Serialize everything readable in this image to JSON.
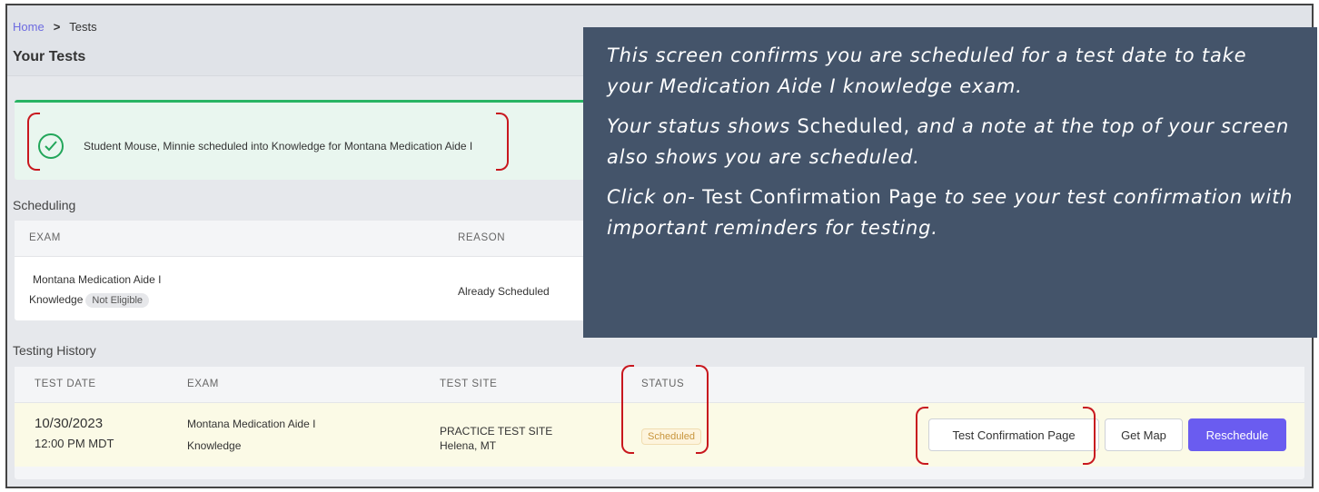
{
  "breadcrumb": {
    "home": "Home",
    "separator": ">",
    "current": "Tests"
  },
  "page_title": "Your Tests",
  "alert": {
    "icon": "check-circle-icon",
    "message": "Student Mouse, Minnie scheduled into Knowledge for Montana Medication Aide I"
  },
  "scheduling": {
    "label": "Scheduling",
    "columns": [
      "EXAM",
      "REASON"
    ],
    "row": {
      "exam": "Montana Medication Aide I",
      "type": "Knowledge",
      "eligibility": "Not Eligible",
      "reason": "Already Scheduled"
    }
  },
  "history": {
    "label": "Testing History",
    "columns": [
      "TEST DATE",
      "EXAM",
      "TEST SITE",
      "STATUS"
    ],
    "row": {
      "date": "10/30/2023",
      "time": "12:00 PM MDT",
      "exam": "Montana Medication Aide I",
      "type": "Knowledge",
      "site": "PRACTICE TEST SITE",
      "location": "Helena, MT",
      "status": "Scheduled"
    },
    "buttons": {
      "confirmation": "Test Confirmation Page",
      "map": "Get Map",
      "reschedule": "Reschedule"
    }
  },
  "overlay": {
    "p1": "This screen confirms you are scheduled for a test date to take your Medication Aide I knowledge exam.",
    "p2_pre": "Your status shows ",
    "p2_bold": "Scheduled,",
    "p2_post": " and a note at the top of your screen also shows you are scheduled.",
    "p3_pre": "Click on- ",
    "p3_bold": "Test Confirmation Page",
    "p3_post": " to see your test confirmation with important reminders for testing."
  },
  "colors": {
    "accent": "#6a5cf0",
    "success": "#28b463",
    "annotation": "#c8171e",
    "overlay_bg": "#44546a",
    "status_scheduled": "#c8953d"
  }
}
